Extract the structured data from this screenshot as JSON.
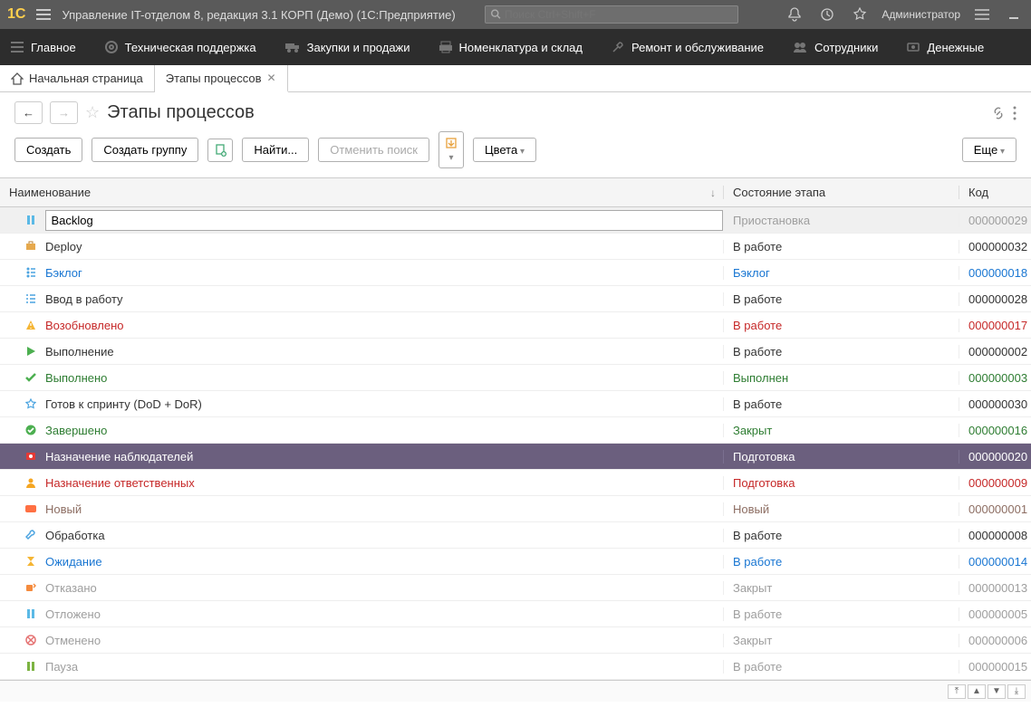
{
  "titlebar": {
    "logo_text": "1С",
    "title": "Управление IT-отделом 8, редакция 3.1 КОРП (Демо)  (1С:Предприятие)",
    "search_placeholder": "Поиск Ctrl+Shift+F",
    "user": "Администратор"
  },
  "nav": {
    "items": [
      {
        "label": "Главное"
      },
      {
        "label": "Техническая поддержка"
      },
      {
        "label": "Закупки и продажи"
      },
      {
        "label": "Номенклатура и склад"
      },
      {
        "label": "Ремонт и обслуживание"
      },
      {
        "label": "Сотрудники"
      },
      {
        "label": "Денежные"
      }
    ]
  },
  "tabs": {
    "home": "Начальная страница",
    "active": "Этапы процессов"
  },
  "page": {
    "title": "Этапы процессов"
  },
  "toolbar": {
    "create": "Создать",
    "create_group": "Создать группу",
    "find": "Найти...",
    "cancel_find": "Отменить поиск",
    "colors": "Цвета",
    "more": "Еще"
  },
  "table": {
    "columns": {
      "name": "Наименование",
      "state": "Состояние этапа",
      "code": "Код"
    },
    "edit_row": {
      "value": "Backlog",
      "state": "Приостановка",
      "code": "000000029"
    },
    "rows": [
      {
        "name": "Deploy",
        "state": "В работе",
        "code": "000000032",
        "color": "black",
        "icon": "deploy"
      },
      {
        "name": "Бэклог",
        "state": "Бэклог",
        "code": "000000018",
        "color": "blue",
        "icon": "backlog"
      },
      {
        "name": "Ввод в работу",
        "state": "В работе",
        "code": "000000028",
        "color": "black",
        "icon": "list"
      },
      {
        "name": "Возобновлено",
        "state": "В работе",
        "code": "000000017",
        "color": "red",
        "icon": "warning"
      },
      {
        "name": "Выполнение",
        "state": "В работе",
        "code": "000000002",
        "color": "black",
        "icon": "play"
      },
      {
        "name": "Выполнено",
        "state": "Выполнен",
        "code": "000000003",
        "color": "green",
        "icon": "check"
      },
      {
        "name": "Готов к спринту (DoD + DoR)",
        "state": "В работе",
        "code": "000000030",
        "color": "black",
        "icon": "star"
      },
      {
        "name": "Завершено",
        "state": "Закрыт",
        "code": "000000016",
        "color": "green",
        "icon": "done"
      },
      {
        "name": "Назначение наблюдателей",
        "state": "Подготовка",
        "code": "000000020",
        "color": "white",
        "icon": "observer",
        "selected": true
      },
      {
        "name": "Назначение ответственных",
        "state": "Подготовка",
        "code": "000000009",
        "color": "red",
        "icon": "person"
      },
      {
        "name": "Новый",
        "state": "Новый",
        "code": "000000001",
        "color": "brown",
        "icon": "new"
      },
      {
        "name": "Обработка",
        "state": "В работе",
        "code": "000000008",
        "color": "black",
        "icon": "wrench"
      },
      {
        "name": "Ожидание",
        "state": "В работе",
        "code": "000000014",
        "color": "blue",
        "icon": "hourglass"
      },
      {
        "name": "Отказано",
        "state": "Закрыт",
        "code": "000000013",
        "color": "gray",
        "icon": "reject"
      },
      {
        "name": "Отложено",
        "state": "В работе",
        "code": "000000005",
        "color": "gray",
        "icon": "pause"
      },
      {
        "name": "Отменено",
        "state": "Закрыт",
        "code": "000000006",
        "color": "gray",
        "icon": "cancel"
      },
      {
        "name": "Пауза",
        "state": "В работе",
        "code": "000000015",
        "color": "gray",
        "icon": "pause2"
      }
    ]
  }
}
